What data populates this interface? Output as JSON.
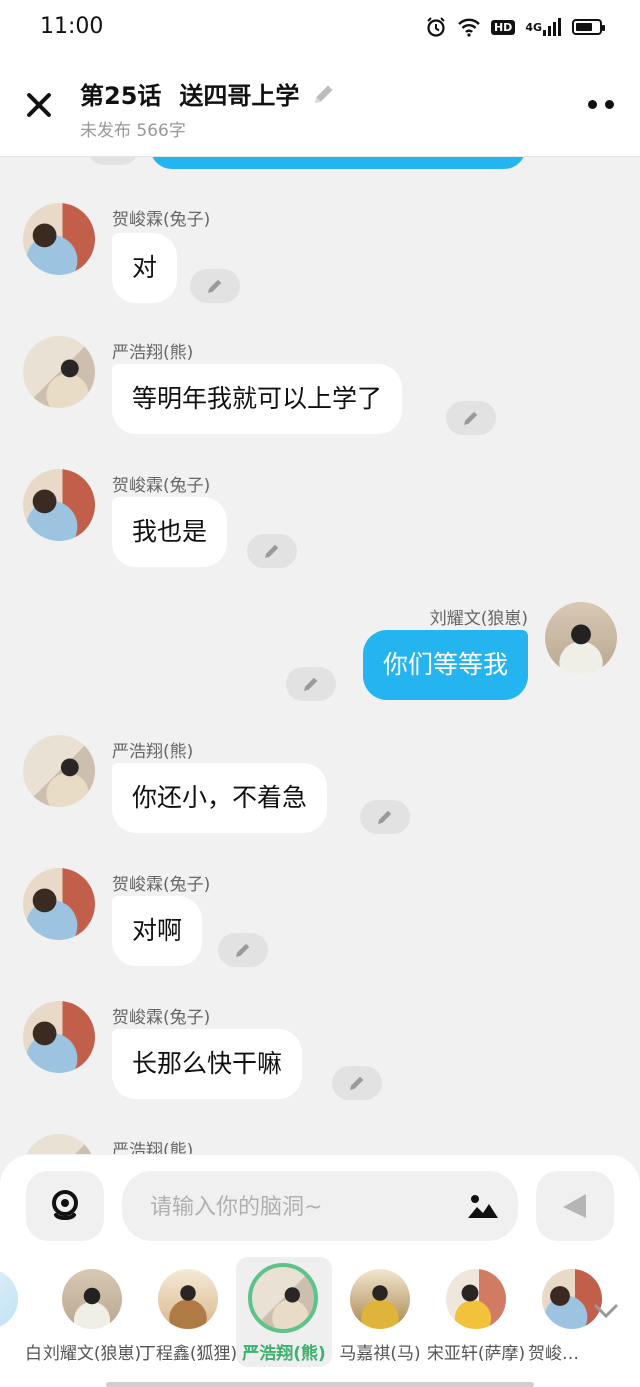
{
  "status_bar": {
    "time": "11:00",
    "hd": "HD",
    "network": "4G"
  },
  "header": {
    "episode": "第25话",
    "title": "送四哥上学",
    "subtitle": "未发布 566字"
  },
  "messages": [
    {
      "side": "left",
      "avatar": "rabbit",
      "name": "贺峻霖(兔子)",
      "text": "对"
    },
    {
      "side": "left",
      "avatar": "bear",
      "name": "严浩翔(熊)",
      "text": "等明年我就可以上学了"
    },
    {
      "side": "left",
      "avatar": "rabbit",
      "name": "贺峻霖(兔子)",
      "text": "我也是"
    },
    {
      "side": "right",
      "avatar": "wolf",
      "name": "刘耀文(狼崽)",
      "text": "你们等等我"
    },
    {
      "side": "left",
      "avatar": "bear",
      "name": "严浩翔(熊)",
      "text": "你还小，不着急"
    },
    {
      "side": "left",
      "avatar": "rabbit",
      "name": "贺峻霖(兔子)",
      "text": "对啊"
    },
    {
      "side": "left",
      "avatar": "rabbit",
      "name": "贺峻霖(兔子)",
      "text": "长那么快干嘛"
    },
    {
      "side": "left",
      "avatar": "bear",
      "name": "严浩翔(熊)",
      "text": ""
    }
  ],
  "composer": {
    "placeholder": "请输入你的脑洞~"
  },
  "characters": [
    {
      "label": "白",
      "active": false
    },
    {
      "label": "刘耀文(狼崽)",
      "active": false
    },
    {
      "label": "丁程鑫(狐狸)",
      "active": false
    },
    {
      "label": "严浩翔(熊)",
      "active": true
    },
    {
      "label": "马嘉祺(马)",
      "active": false
    },
    {
      "label": "宋亚轩(萨摩)",
      "active": false
    },
    {
      "label": "贺峻霖(兔子)",
      "active": false
    }
  ],
  "colors": {
    "accent_blue": "#24b5f0",
    "active_green": "#5cc38a"
  }
}
